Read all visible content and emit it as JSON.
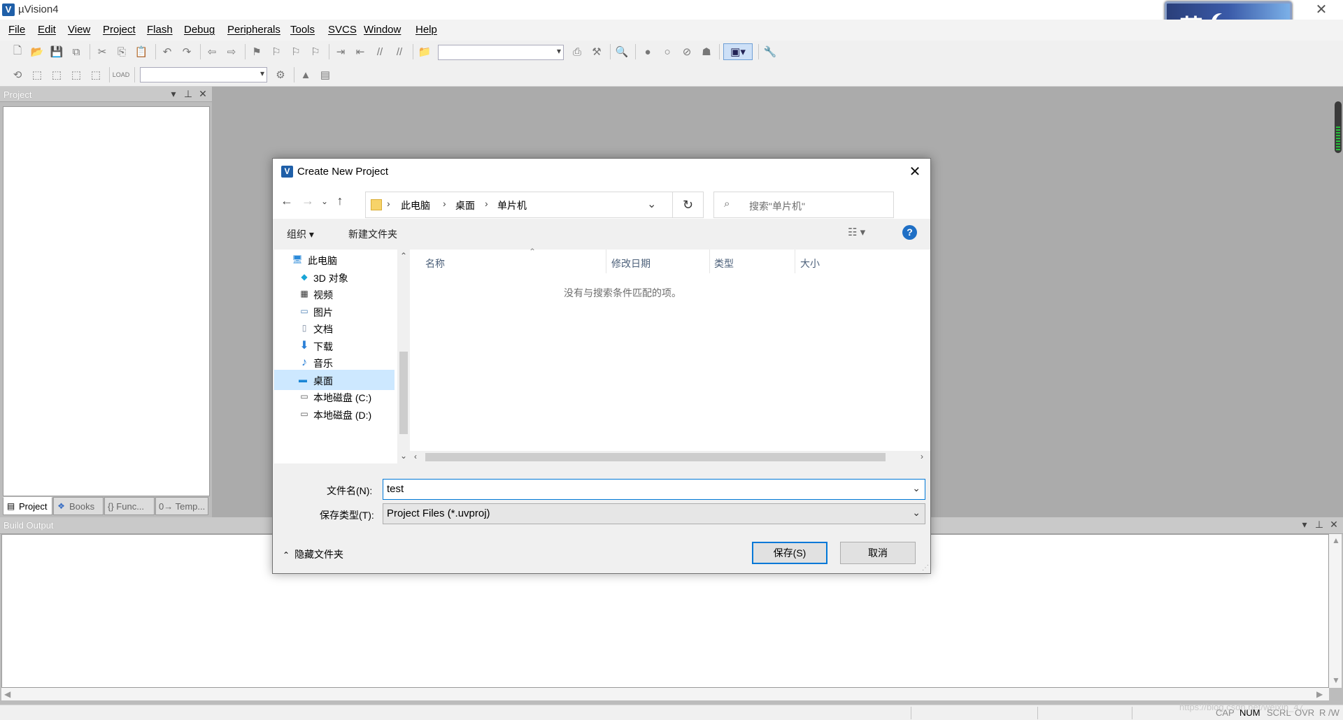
{
  "window": {
    "title": "µVision4",
    "close_glyph": "✕",
    "ime_char": "英"
  },
  "menubar": [
    "File",
    "Edit",
    "View",
    "Project",
    "Flash",
    "Debug",
    "Peripherals",
    "Tools",
    "SVCS",
    "Window",
    "Help"
  ],
  "project_panel": {
    "title": "Project",
    "tabs": [
      "Project",
      "Books",
      "{} Func...",
      "0→ Temp..."
    ]
  },
  "build_output": {
    "title": "Build Output"
  },
  "statusbar": {
    "indicators": [
      "CAP",
      "NUM",
      "SCRL",
      "OVR",
      "R /W"
    ],
    "active_indicator": "NUM",
    "watermark": "https://blog.csdn.net/weixin_47..."
  },
  "dialog": {
    "title": "Create New Project",
    "breadcrumb": [
      "此电脑",
      "桌面",
      "单片机"
    ],
    "search_placeholder": "搜索\"单片机\"",
    "commands": {
      "organize": "组织 ▾",
      "new_folder": "新建文件夹"
    },
    "nav_items": [
      {
        "label": "此电脑",
        "icon": "computer-icon"
      },
      {
        "label": "3D 对象",
        "icon": "cube-icon"
      },
      {
        "label": "视频",
        "icon": "video-icon"
      },
      {
        "label": "图片",
        "icon": "picture-icon"
      },
      {
        "label": "文档",
        "icon": "document-icon"
      },
      {
        "label": "下载",
        "icon": "download-icon"
      },
      {
        "label": "音乐",
        "icon": "music-icon"
      },
      {
        "label": "桌面",
        "icon": "desktop-icon"
      },
      {
        "label": "本地磁盘 (C:)",
        "icon": "drive-icon"
      },
      {
        "label": "本地磁盘 (D:)",
        "icon": "drive-icon"
      }
    ],
    "selected_nav": "桌面",
    "columns": [
      "名称",
      "修改日期",
      "类型",
      "大小"
    ],
    "empty_message": "没有与搜索条件匹配的项。",
    "filename_label": "文件名(N):",
    "filename_value": "test",
    "filetype_label": "保存类型(T):",
    "filetype_value": "Project Files (*.uvproj)",
    "hide_folders": "隐藏文件夹",
    "save_button": "保存(S)",
    "cancel_button": "取消"
  }
}
